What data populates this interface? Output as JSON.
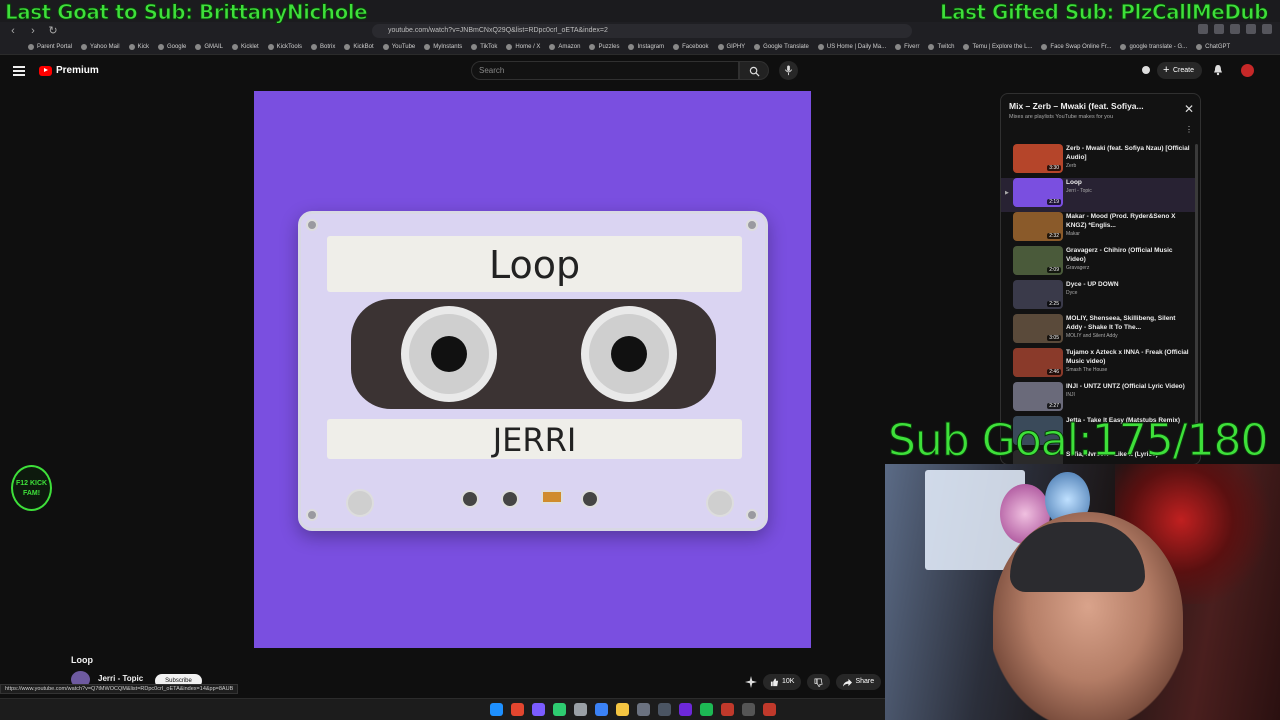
{
  "overlay": {
    "last_goat": "Last Goat to Sub: BrittanyNichole",
    "last_gifted": "Last Gifted Sub: PlzCallMeDub",
    "sub_goal": "Sub Goal:175/180",
    "badge_text": "F12 KICK FAM!"
  },
  "browser": {
    "url": "youtube.com/watch?v=JNBmCNxQ29Q&list=RDpc0crI_oETA&index=2",
    "bookmarks": [
      "Parent Portal",
      "Yahoo Mail",
      "Kick",
      "Google",
      "GMAIL",
      "Kicklet",
      "KickTools",
      "Botrix",
      "KickBot",
      "YouTube",
      "MyInstants",
      "TikTok",
      "Home / X",
      "Amazon",
      "Puzzles",
      "Instagram",
      "Facebook",
      "GIPHY",
      "Google Translate",
      "US Home | Daily Ma...",
      "Fiverr",
      "Twitch",
      "Temu | Explore the L...",
      "Face Swap Online Fr...",
      "google translate - G...",
      "ChatGPT"
    ],
    "link_preview": "https://www.youtube.com/watch?v=Q7tMWOCQM&list=RDpc0crI_oETA&index=14&pp=8AUB"
  },
  "header": {
    "brand": "Premium",
    "search_placeholder": "Search",
    "create_label": "Create"
  },
  "album": {
    "label_top": "Loop",
    "label_bottom": "JERRI"
  },
  "video": {
    "title": "Loop",
    "channel": "Jerri - Topic",
    "subscribe": "Subscribe",
    "likes": "10K",
    "share": "Share"
  },
  "playlist": {
    "title": "Mix – Zerb – Mwaki (feat. Sofiya...",
    "subtitle": "Mixes are playlists YouTube makes for you",
    "items": [
      {
        "title": "Zerb - Mwaki (feat. Sofiya Nzau) [Official Audio]",
        "artist": "Zerb",
        "duration": "3:30",
        "color": "#b5452a"
      },
      {
        "title": "Loop",
        "artist": "Jerri - Topic",
        "duration": "2:19",
        "color": "#7a4fe0",
        "active": true
      },
      {
        "title": "Makar - Mood (Prod. Ryder&Seno X KNGZ) *Englis...",
        "artist": "Makar",
        "duration": "2:32",
        "color": "#8a5a2a"
      },
      {
        "title": "Gravagerz - Chihiro (Official Music Video)",
        "artist": "Gravagerz",
        "duration": "2:09",
        "color": "#4a5a3a"
      },
      {
        "title": "Dyce - UP DOWN",
        "artist": "Dyce",
        "duration": "2:25",
        "color": "#3a3a4a"
      },
      {
        "title": "MOLIY, Shenseea, Skillibeng, Silent Addy - Shake It To The...",
        "artist": "MOLIY and Silent Addy",
        "duration": "3:05",
        "color": "#5a4a3a"
      },
      {
        "title": "Tujamo x Azteck x INNA - Freak (Official Music video)",
        "artist": "Smash The House",
        "duration": "2:46",
        "color": "#8a3a2a"
      },
      {
        "title": "INJI - UNTZ UNTZ (Official Lyric Video)",
        "artist": "INJI",
        "duration": "2:27",
        "color": "#6a6a7a"
      },
      {
        "title": "Jetta - Take It Easy (Matstubs Remix)",
        "artist": "",
        "duration": "",
        "color": "#3a4a5a"
      },
      {
        "title": "Sofia, Nvrsoft - Like It (Lyrics)",
        "artist": "",
        "duration": "",
        "color": "#2a2a2a"
      }
    ]
  },
  "colors": {
    "overlay_green": "#3ee03a",
    "album_purple": "#7a4fe0",
    "yt_red": "#ff0000"
  }
}
